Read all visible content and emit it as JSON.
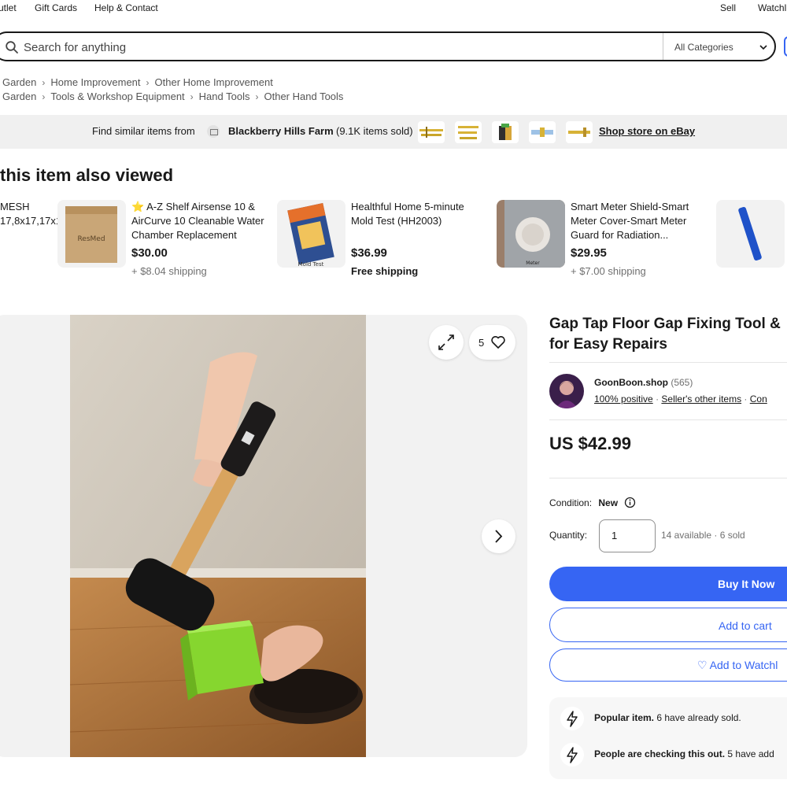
{
  "topnav": {
    "left": [
      "utlet",
      "Gift Cards",
      "Help & Contact"
    ],
    "right": [
      "Sell",
      "Watchl"
    ]
  },
  "search": {
    "placeholder": "Search for anything",
    "category": "All Categories"
  },
  "breadcrumbs": [
    [
      "Garden",
      "Home Improvement",
      "Other Home Improvement"
    ],
    [
      "Garden",
      "Tools & Workshop Equipment",
      "Hand Tools",
      "Other Hand Tools"
    ]
  ],
  "similar": {
    "prefix": "Find similar items from",
    "store": "Blackberry Hills Farm",
    "sold": "(9.1K items sold)",
    "link": "Shop store on eBay"
  },
  "also_viewed": {
    "title": "this item also viewed",
    "partial": "MESH\n17,8x17,17x1",
    "items": [
      {
        "title": "⭐ A-Z Shelf Airsense 10 & AirCurve 10 Cleanable Water Chamber Replacement",
        "price": "$30.00",
        "shipping": "+ $8.04 shipping",
        "img_label": "ResMed"
      },
      {
        "title": "Healthful Home 5-minute Mold Test (HH2003)",
        "price": "$36.99",
        "shipping": "Free shipping",
        "img_label": "Mold Test"
      },
      {
        "title": "Smart Meter Shield-Smart Meter Cover-Smart Meter Guard for Radiation...",
        "price": "$29.95",
        "shipping": "+ $7.00 shipping",
        "img_label": "Meter"
      }
    ]
  },
  "gallery": {
    "watch_count": "5"
  },
  "product": {
    "title": "Gap Tap Floor Gap Fixing Tool & for Easy Repairs",
    "seller_name": "GoonBoon.shop",
    "seller_count": "(565)",
    "positive": "100% positive",
    "other_items": "Seller's other items",
    "contact": "Con",
    "price": "US $42.99",
    "condition_label": "Condition:",
    "condition_value": "New",
    "quantity_label": "Quantity:",
    "quantity_value": "1",
    "availability": "14 available · 6 sold",
    "buy_now": "Buy It Now",
    "add_to_cart": "Add to cart",
    "watchlist": "♡ Add to Watchl"
  },
  "info": [
    {
      "bold": "Popular item.",
      "text": " 6 have already sold."
    },
    {
      "bold": "People are checking this out.",
      "text": " 5 have add"
    }
  ],
  "colors": {
    "accent": "#3665f3",
    "product_green": "#8ee03a"
  }
}
